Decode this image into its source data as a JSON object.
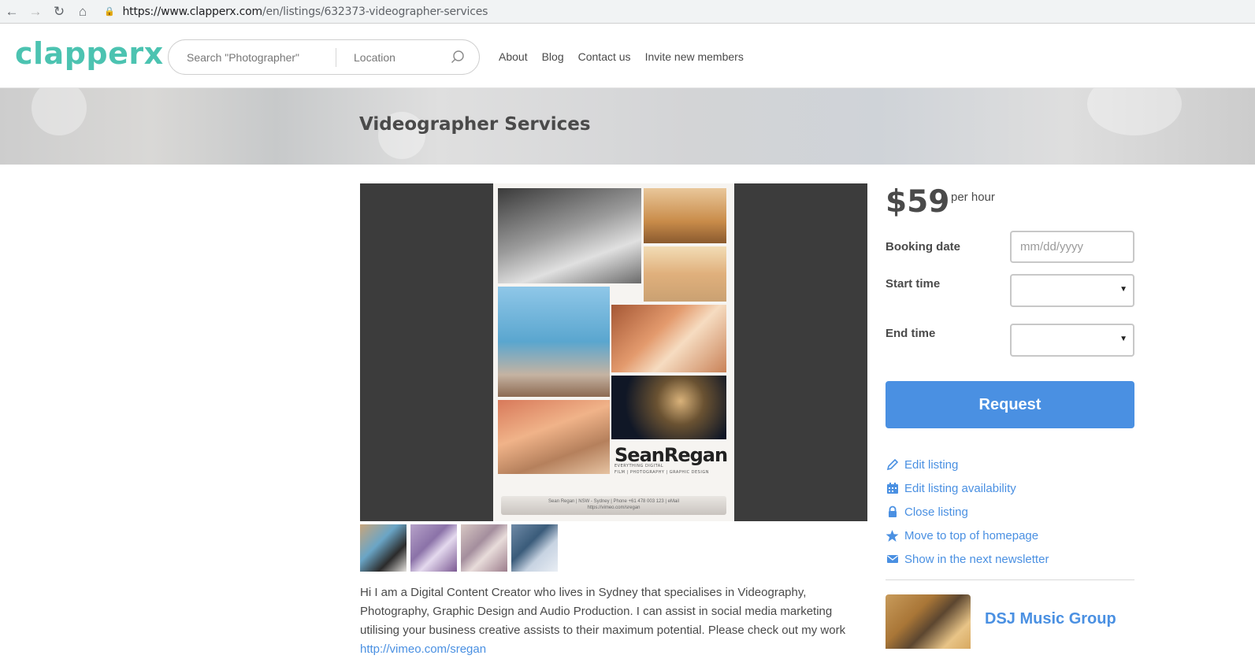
{
  "browser": {
    "url_host": "https://www.clapperx.com",
    "url_path": "/en/listings/632373-videographer-services"
  },
  "header": {
    "logo": "clapperx",
    "search_placeholder": "Search \"Photographer\"",
    "location_placeholder": "Location",
    "nav": [
      "About",
      "Blog",
      "Contact us",
      "Invite new members"
    ]
  },
  "listing": {
    "title": "Videographer Services",
    "price": "$59",
    "price_unit": "per hour",
    "thumbnail_count": 4,
    "poster_logo": "SeanRegan",
    "poster_logo_sub": "EVERYTHING DIGITAL",
    "poster_tagline": "FILM | PHOTOGRAPHY | GRAPHIC DESIGN",
    "poster_contact": "Sean Regan | NSW - Sydney | Phone +61 478 003 123 | eMail",
    "poster_vimeo": "https://vimeo.com/sregan",
    "description": "Hi I am a Digital Content Creator who lives in Sydney that specialises in Videography, Photography, Graphic Design and Audio Production. I can assist in social media marketing utilising your business creative assists to their maximum potential. Please check out my work",
    "description_link": "http://vimeo.com/sregan"
  },
  "booking": {
    "date_label": "Booking date",
    "date_placeholder": "mm/dd/yyyy",
    "start_label": "Start time",
    "end_label": "End time",
    "request_label": "Request"
  },
  "actions": [
    {
      "label": "Edit listing",
      "icon": "pencil-icon"
    },
    {
      "label": "Edit listing availability",
      "icon": "calendar-icon"
    },
    {
      "label": "Close listing",
      "icon": "lock-icon"
    },
    {
      "label": "Move to top of homepage",
      "icon": "star-icon"
    },
    {
      "label": "Show in the next newsletter",
      "icon": "envelope-icon"
    }
  ],
  "author": {
    "name": "DSJ Music Group"
  },
  "colors": {
    "brand": "#4cc3b1",
    "accent": "#4a90e2",
    "text": "#4a4a4a"
  }
}
